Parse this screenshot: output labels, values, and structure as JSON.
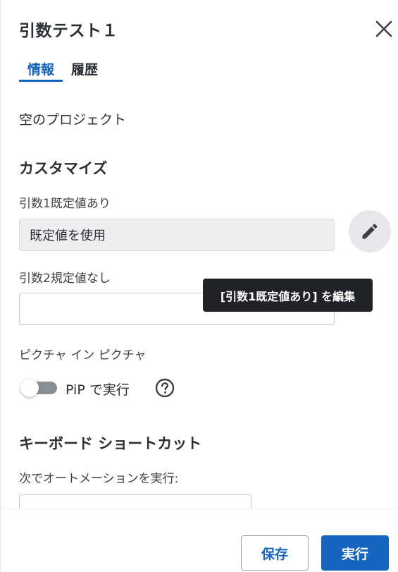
{
  "dialog": {
    "title": "引数テスト１"
  },
  "tabs": [
    {
      "label": "情報",
      "active": true
    },
    {
      "label": "履歴",
      "active": false
    }
  ],
  "info": {
    "project_text": "空のプロジェクト"
  },
  "customize": {
    "heading": "カスタマイズ",
    "arg1": {
      "label": "引数1既定値あり",
      "value": "既定値を使用"
    },
    "arg2": {
      "label": "引数2規定値なし",
      "value": ""
    },
    "edit_tooltip": "[引数1既定値あり] を編集"
  },
  "pip": {
    "heading": "ピクチャ イン ピクチャ",
    "toggle_label": "PiP で実行",
    "enabled": false
  },
  "shortcut": {
    "heading": "キーボード ショートカット",
    "label": "次でオートメーションを実行:",
    "value": ""
  },
  "footer": {
    "save_label": "保存",
    "run_label": "実行"
  },
  "colors": {
    "accent": "#1565c0",
    "tooltip_bg": "#1f2328",
    "disabled_field_bg": "#eceef0"
  },
  "icons": {
    "close": "close-icon",
    "edit": "pencil-icon",
    "help": "help-circle-icon"
  }
}
